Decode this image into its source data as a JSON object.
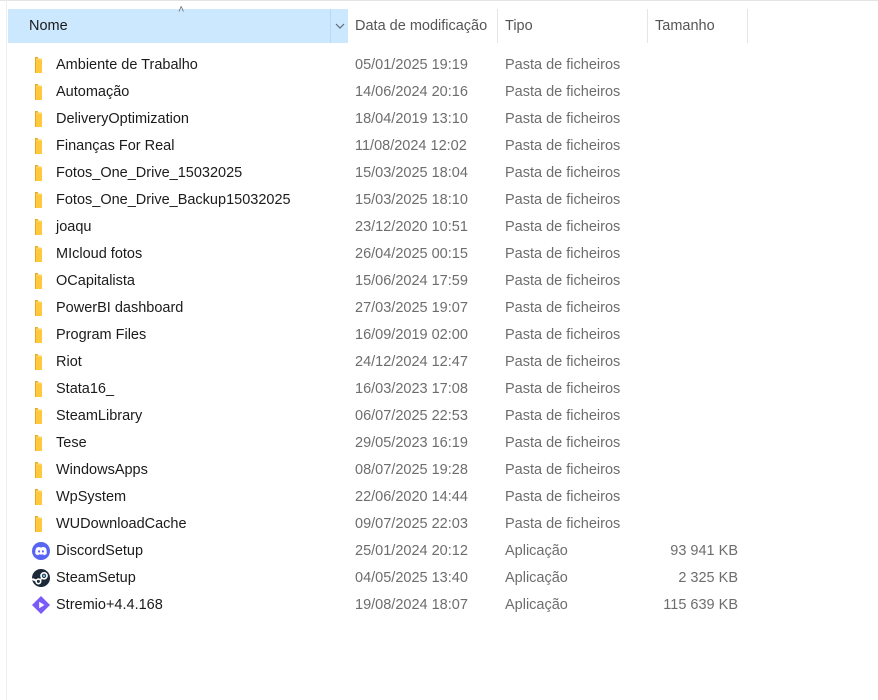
{
  "header": {
    "name_label": "Nome",
    "date_label": "Data de modificação",
    "type_label": "Tipo",
    "size_label": "Tamanho"
  },
  "colors": {
    "sorted_header_bg": "#cce8ff",
    "folder": "#ffc83d",
    "discord": "#5865f2",
    "steam": "#1b2838",
    "stremio": "#7b5bf5"
  },
  "rows": [
    {
      "name": "Ambiente de Trabalho",
      "date": "05/01/2025 19:19",
      "type": "Pasta de ficheiros",
      "size": "",
      "icon": "folder-icon"
    },
    {
      "name": "Automação",
      "date": "14/06/2024 20:16",
      "type": "Pasta de ficheiros",
      "size": "",
      "icon": "folder-icon"
    },
    {
      "name": "DeliveryOptimization",
      "date": "18/04/2019 13:10",
      "type": "Pasta de ficheiros",
      "size": "",
      "icon": "folder-icon"
    },
    {
      "name": "Finanças For Real",
      "date": "11/08/2024 12:02",
      "type": "Pasta de ficheiros",
      "size": "",
      "icon": "folder-icon"
    },
    {
      "name": "Fotos_One_Drive_15032025",
      "date": "15/03/2025 18:04",
      "type": "Pasta de ficheiros",
      "size": "",
      "icon": "folder-icon"
    },
    {
      "name": "Fotos_One_Drive_Backup15032025",
      "date": "15/03/2025 18:10",
      "type": "Pasta de ficheiros",
      "size": "",
      "icon": "folder-icon"
    },
    {
      "name": "joaqu",
      "date": "23/12/2020 10:51",
      "type": "Pasta de ficheiros",
      "size": "",
      "icon": "folder-icon"
    },
    {
      "name": "MIcloud fotos",
      "date": "26/04/2025 00:15",
      "type": "Pasta de ficheiros",
      "size": "",
      "icon": "folder-icon"
    },
    {
      "name": "OCapitalista",
      "date": "15/06/2024 17:59",
      "type": "Pasta de ficheiros",
      "size": "",
      "icon": "folder-icon"
    },
    {
      "name": "PowerBI dashboard",
      "date": "27/03/2025 19:07",
      "type": "Pasta de ficheiros",
      "size": "",
      "icon": "folder-icon"
    },
    {
      "name": "Program Files",
      "date": "16/09/2019 02:00",
      "type": "Pasta de ficheiros",
      "size": "",
      "icon": "folder-icon"
    },
    {
      "name": "Riot",
      "date": "24/12/2024 12:47",
      "type": "Pasta de ficheiros",
      "size": "",
      "icon": "folder-icon"
    },
    {
      "name": "Stata16_",
      "date": "16/03/2023 17:08",
      "type": "Pasta de ficheiros",
      "size": "",
      "icon": "folder-icon"
    },
    {
      "name": "SteamLibrary",
      "date": "06/07/2025 22:53",
      "type": "Pasta de ficheiros",
      "size": "",
      "icon": "folder-icon"
    },
    {
      "name": "Tese",
      "date": "29/05/2023 16:19",
      "type": "Pasta de ficheiros",
      "size": "",
      "icon": "folder-icon"
    },
    {
      "name": "WindowsApps",
      "date": "08/07/2025 19:28",
      "type": "Pasta de ficheiros",
      "size": "",
      "icon": "folder-icon"
    },
    {
      "name": "WpSystem",
      "date": "22/06/2020 14:44",
      "type": "Pasta de ficheiros",
      "size": "",
      "icon": "folder-icon"
    },
    {
      "name": "WUDownloadCache",
      "date": "09/07/2025 22:03",
      "type": "Pasta de ficheiros",
      "size": "",
      "icon": "folder-icon"
    },
    {
      "name": "DiscordSetup",
      "date": "25/01/2024 20:12",
      "type": "Aplicação",
      "size": "93 941 KB",
      "icon": "discord-icon"
    },
    {
      "name": "SteamSetup",
      "date": "04/05/2025 13:40",
      "type": "Aplicação",
      "size": "2 325 KB",
      "icon": "steam-icon"
    },
    {
      "name": "Stremio+4.4.168",
      "date": "19/08/2024 18:07",
      "type": "Aplicação",
      "size": "115 639 KB",
      "icon": "stremio-icon"
    }
  ]
}
